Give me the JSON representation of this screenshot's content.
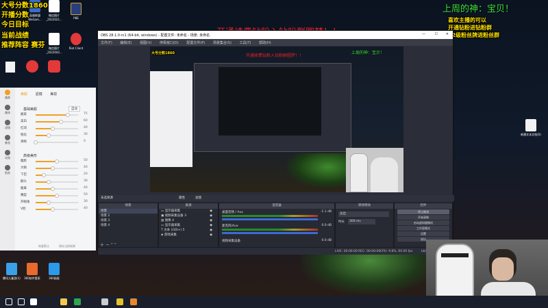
{
  "overlay": {
    "left_lines": [
      "大号分数1860",
      "开播分数",
      "今日目标",
      "当前战绩",
      "推荐阵容 赛芬"
    ],
    "top_banner": "开通续费钻粉入钻粉群圆梦！！",
    "top_right_title": "上周的神：宝贝！",
    "top_right_lines": [
      "喜欢主播的可以",
      "开通钻粉进钻粉群",
      "12级粉丝牌进粉丝群"
    ]
  },
  "desktop_icons": [
    {
      "label": "英雄联盟WeGam...",
      "color": "#3a6cc8"
    },
    {
      "label": "微信图片_2022021...",
      "color": "#ffffff"
    },
    {
      "label": "PBE",
      "color": "#2a3e7a"
    },
    {
      "label": "微信图片_2022042...",
      "color": "#ffffff"
    },
    {
      "label": "Riot Client",
      "color": "#e23a3a"
    },
    {
      "label": "新建文本文档(6)",
      "color": "#f2f2f2"
    },
    {
      "label": "腾讯儿童游(1)",
      "color": "#3aa0e8"
    },
    {
      "label": "360软件管家",
      "color": "#e86a2c"
    },
    {
      "label": "360画报",
      "color": "#2c9ae8"
    }
  ],
  "beauty_panel": {
    "tabs": [
      "美颜",
      "滤镜",
      "美妆"
    ],
    "side_items": [
      "美颜",
      "美体",
      "滤镜",
      "美妆",
      "动效",
      "贴纸"
    ],
    "section1": "基础美颜",
    "section2": "高级美形",
    "section1_mode": "自动",
    "sliders": [
      {
        "label": "磨皮",
        "value": 75,
        "fill": 0.75
      },
      {
        "label": "美白",
        "value": 60,
        "fill": 0.6
      },
      {
        "label": "红润",
        "value": 40,
        "fill": 0.4
      },
      {
        "label": "锐化",
        "value": 30,
        "fill": 0.3
      },
      {
        "label": "清晰",
        "value": 0,
        "fill": 0.0
      },
      {
        "label": "瘦脸",
        "value": 50,
        "fill": 0.5
      },
      {
        "label": "大眼",
        "value": 40,
        "fill": 0.4
      },
      {
        "label": "下巴",
        "value": 20,
        "fill": 0.2
      },
      {
        "label": "额头",
        "value": 30,
        "fill": 0.3
      },
      {
        "label": "瘦鼻",
        "value": 40,
        "fill": 0.4
      },
      {
        "label": "嘴型",
        "value": 50,
        "fill": 0.5
      },
      {
        "label": "开眼角",
        "value": 30,
        "fill": 0.3
      },
      {
        "label": "V脸",
        "value": 40,
        "fill": 0.4
      }
    ],
    "footer_buttons": [
      "恢复默认",
      "保存当前效果"
    ]
  },
  "obs": {
    "title": "OBS 28.1.0-rc1 (64-bit, windows) - 配置文件: 未命名 - 场景: 未命名",
    "menu": [
      "文件(F)",
      "编辑(E)",
      "视图(V)",
      "停靠窗口(D)",
      "配置文件(P)",
      "场景集合(S)",
      "工具(T)",
      "帮助(H)"
    ],
    "no_source": "未选择源",
    "props_btn": "属性",
    "filters_btn": "滤镜",
    "docks": {
      "scenes": "场景",
      "sources": "来源",
      "mixer": "混音器",
      "transitions": "转场特效",
      "controls": "控件"
    },
    "scenes": [
      "场景",
      "场景 2",
      "场景 3",
      "场景 4"
    ],
    "sources": [
      "显示器采集",
      "视频采集设备 3",
      "图像 4",
      "显示器采集",
      "文本 (GDI+) 5",
      "游戏采集"
    ],
    "mixer": [
      {
        "name": "桌面音频 / Aux",
        "db": "-1.1 dB"
      },
      {
        "name": "麦克风/Aux",
        "db": "0.0 dB"
      },
      {
        "name": "视频采集设备",
        "db": "0.0 dB"
      }
    ],
    "transition": {
      "type": "淡出",
      "label": "时长",
      "duration": "300 ms"
    },
    "controls": [
      "停止推流",
      "开始录制",
      "启动虚拟摄像机",
      "工作室模式",
      "设置",
      "退出"
    ],
    "status": {
      "live": "LIVE: 00:00:00",
      "rec": "REC: 00:00:00",
      "cpu": "CPU: 9.8%, 60.00 fps",
      "kbps": "kb/s"
    }
  },
  "taskbar": {
    "icons": [
      {
        "name": "start",
        "color": "#ffffff"
      },
      {
        "name": "search",
        "color": "#ffffff"
      },
      {
        "name": "taskview",
        "color": "#ffffff"
      },
      {
        "name": "explorer",
        "color": "#f2c94c"
      },
      {
        "name": "chrome",
        "color": "#2fa84f"
      },
      {
        "name": "obs",
        "color": "#cccccc"
      },
      {
        "name": "browser",
        "color": "#e8c02c"
      },
      {
        "name": "app",
        "color": "#e8882c"
      }
    ]
  }
}
